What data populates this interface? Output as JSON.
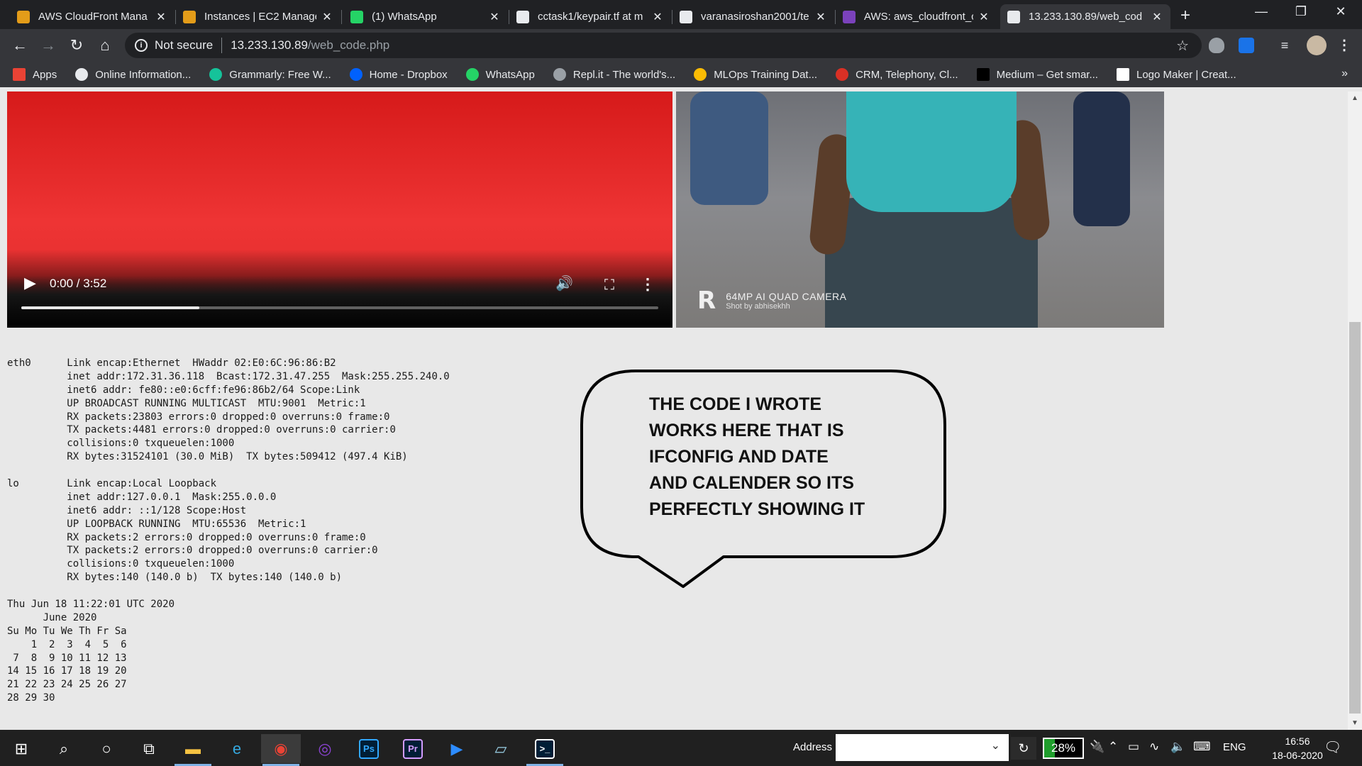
{
  "browser": {
    "tabs": [
      {
        "title": "AWS CloudFront Mana",
        "favicon": "aws-box-icon",
        "color": "#e39c19",
        "active": false
      },
      {
        "title": "Instances | EC2 Manage",
        "favicon": "aws-box-icon",
        "color": "#e39c19",
        "active": false
      },
      {
        "title": "(1) WhatsApp",
        "favicon": "whatsapp-icon",
        "color": "#25d366",
        "active": false
      },
      {
        "title": "cctask1/keypair.tf at m",
        "favicon": "github-icon",
        "color": "#e8eaed",
        "active": false
      },
      {
        "title": "varanasiroshan2001/te",
        "favicon": "github-icon",
        "color": "#e8eaed",
        "active": false
      },
      {
        "title": "AWS: aws_cloudfront_c",
        "favicon": "terraform-icon",
        "color": "#7b42bc",
        "active": false
      },
      {
        "title": "13.233.130.89/web_cod",
        "favicon": "globe-icon",
        "color": "#e8eaed",
        "active": true
      }
    ],
    "new_tab_glyph": "+",
    "security_label": "Not secure",
    "url_host": "13.233.130.89",
    "url_path": "/web_code.php",
    "bookmarks": [
      {
        "label": "Apps",
        "icon": "apps-grid-icon",
        "color": "#ea4335"
      },
      {
        "label": "Online Information...",
        "icon": "globe-icon",
        "color": "#e8eaed"
      },
      {
        "label": "Grammarly: Free W...",
        "icon": "grammarly-icon",
        "color": "#15c39a"
      },
      {
        "label": "Home - Dropbox",
        "icon": "dropbox-icon",
        "color": "#0061fe"
      },
      {
        "label": "WhatsApp",
        "icon": "whatsapp-icon",
        "color": "#25d366"
      },
      {
        "label": "Repl.it - The world's...",
        "icon": "replit-icon",
        "color": "#9aa0a6"
      },
      {
        "label": "MLOps Training Dat...",
        "icon": "google-drive-icon",
        "color": "#fbbc04"
      },
      {
        "label": "CRM, Telephony, Cl...",
        "icon": "crm-icon",
        "color": "#d93025"
      },
      {
        "label": "Medium – Get smar...",
        "icon": "medium-icon",
        "color": "#000000"
      },
      {
        "label": "Logo Maker | Creat...",
        "icon": "wix-icon",
        "color": "#ffffff"
      }
    ],
    "bookmarks_more": "»"
  },
  "video": {
    "time": "0:00 / 3:52",
    "buffered_fraction": 0.28
  },
  "photo": {
    "watermark_line1": "64MP AI QUAD CAMERA",
    "watermark_line2": "Shot by abhisekhh",
    "logo_glyph": "R"
  },
  "terminal": {
    "lines": [
      "eth0      Link encap:Ethernet  HWaddr 02:E0:6C:96:86:B2",
      "          inet addr:172.31.36.118  Bcast:172.31.47.255  Mask:255.255.240.0",
      "          inet6 addr: fe80::e0:6cff:fe96:86b2/64 Scope:Link",
      "          UP BROADCAST RUNNING MULTICAST  MTU:9001  Metric:1",
      "          RX packets:23803 errors:0 dropped:0 overruns:0 frame:0",
      "          TX packets:4481 errors:0 dropped:0 overruns:0 carrier:0",
      "          collisions:0 txqueuelen:1000",
      "          RX bytes:31524101 (30.0 MiB)  TX bytes:509412 (497.4 KiB)",
      "",
      "lo        Link encap:Local Loopback",
      "          inet addr:127.0.0.1  Mask:255.0.0.0",
      "          inet6 addr: ::1/128 Scope:Host",
      "          UP LOOPBACK RUNNING  MTU:65536  Metric:1",
      "          RX packets:2 errors:0 dropped:0 overruns:0 frame:0",
      "          TX packets:2 errors:0 dropped:0 overruns:0 carrier:0",
      "          collisions:0 txqueuelen:1000",
      "          RX bytes:140 (140.0 b)  TX bytes:140 (140.0 b)",
      "",
      "Thu Jun 18 11:22:01 UTC 2020",
      "      June 2020",
      "Su Mo Tu We Th Fr Sa",
      "    1  2  3  4  5  6",
      " 7  8  9 10 11 12 13",
      "14 15 16 17 18 19 20",
      "21 22 23 24 25 26 27",
      "28 29 30"
    ]
  },
  "callout": {
    "lines": [
      "THE CODE I WROTE",
      "WORKS HERE THAT IS",
      "IFCONFIG AND DATE",
      "AND CALENDER SO ITS",
      "PERFECTLY SHOWING IT"
    ]
  },
  "taskbar": {
    "apps": [
      {
        "name": "windows-start-icon",
        "glyph": "⊞",
        "color": "#ffffff",
        "open": false
      },
      {
        "name": "search-icon",
        "glyph": "⌕",
        "color": "#ffffff",
        "open": false
      },
      {
        "name": "cortana-icon",
        "glyph": "○",
        "color": "#ffffff",
        "open": false
      },
      {
        "name": "task-view-icon",
        "glyph": "⧉",
        "color": "#ffffff",
        "open": false
      },
      {
        "name": "file-explorer-icon",
        "glyph": "▬",
        "color": "#f6c342",
        "open": true
      },
      {
        "name": "edge-icon",
        "glyph": "e",
        "color": "#35a9e0",
        "open": false
      },
      {
        "name": "chrome-icon",
        "glyph": "◉",
        "color": "#ea4335",
        "open": true
      },
      {
        "name": "media-player-icon",
        "glyph": "◎",
        "color": "#8e44d6",
        "open": false
      },
      {
        "name": "photoshop-icon",
        "glyph": "Ps",
        "color": "#31a8ff",
        "open": false
      },
      {
        "name": "premiere-icon",
        "glyph": "Pr",
        "color": "#d49cff",
        "open": false
      },
      {
        "name": "zoom-icon",
        "glyph": "▶",
        "color": "#2d8cff",
        "open": false
      },
      {
        "name": "notepad-icon",
        "glyph": "▱",
        "color": "#9ad0e6",
        "open": false
      },
      {
        "name": "terminal-icon",
        "glyph": ">_",
        "color": "#ffffff",
        "open": true
      }
    ],
    "address_label": "Address",
    "battery_percent": "28%",
    "battery_fraction": 0.28,
    "language": "ENG",
    "time": "16:56",
    "date": "18-06-2020"
  }
}
